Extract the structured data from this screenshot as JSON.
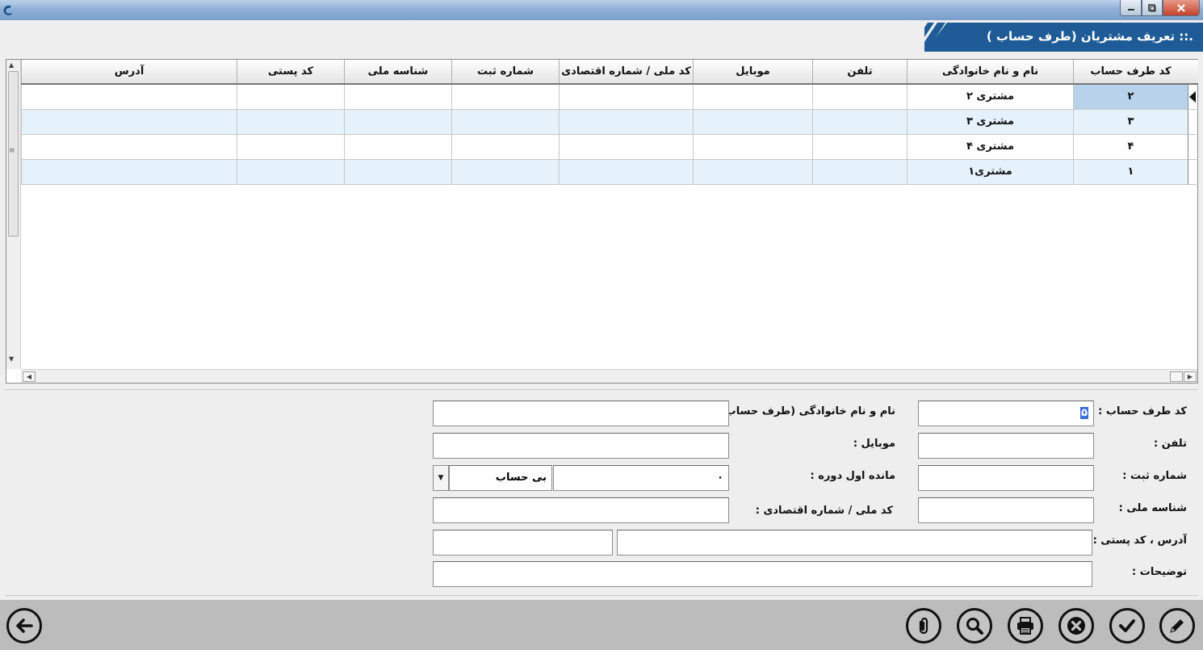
{
  "window": {
    "title": "",
    "buttons": {
      "minimize": "minimize-icon",
      "maximize": "maximize-icon",
      "close": "close-icon"
    }
  },
  "header": {
    "title": ".:: تعریف مشتریان (طرف حساب )",
    "banner_color": "#1f5b96"
  },
  "grid": {
    "columns": [
      "کد طرف حساب",
      "نام و نام خانوادگی",
      "تلفن",
      "موبایل",
      "کد ملی / شماره اقتصادی",
      "شماره ثبت",
      "شناسه ملی",
      "کد پستی",
      "آدرس"
    ],
    "rows": [
      {
        "code": "۲",
        "name": "مشتری ۲",
        "phone": "",
        "mobile": "",
        "national_code": "",
        "reg_no": "",
        "national_id": "",
        "postal": "",
        "address": ""
      },
      {
        "code": "۳",
        "name": "مشتری ۳",
        "phone": "",
        "mobile": "",
        "national_code": "",
        "reg_no": "",
        "national_id": "",
        "postal": "",
        "address": ""
      },
      {
        "code": "۴",
        "name": "مشتری ۴",
        "phone": "",
        "mobile": "",
        "national_code": "",
        "reg_no": "",
        "national_id": "",
        "postal": "",
        "address": ""
      },
      {
        "code": "۱",
        "name": "مشتری۱",
        "phone": "",
        "mobile": "",
        "national_code": "",
        "reg_no": "",
        "national_id": "",
        "postal": "",
        "address": ""
      }
    ],
    "selected_row": 0,
    "colors": {
      "alt_row": "#e5f2fc",
      "selected_cell": "#b9d2ec"
    }
  },
  "form": {
    "code_label": "کد طرف حساب :",
    "code_value": "۵",
    "name_label": "نام و نام خانوادگی (طرف حساب ) :",
    "name_value": "",
    "phone_label": "تلفن :",
    "phone_value": "",
    "mobile_label": "موبایل :",
    "mobile_value": "",
    "reg_label": "شماره ثبت :",
    "reg_value": "",
    "balance_label": "مانده اول دوره :",
    "balance_value": "۰",
    "balance_type": "بی حساب",
    "national_id_label": "شناسه ملی :",
    "national_id_value": "",
    "national_code_label": "کد ملی / شماره اقتصادی :",
    "national_code_value": "",
    "address_label": "آدرس ، کد پستی :",
    "address_value": "",
    "postal_value": "",
    "notes_label": "توضیحات :",
    "notes_value": ""
  },
  "toolbar": {
    "buttons": [
      "edit-icon",
      "confirm-icon",
      "cancel-icon",
      "print-icon",
      "search-icon",
      "attach-icon"
    ],
    "back": "back-arrow-icon"
  }
}
